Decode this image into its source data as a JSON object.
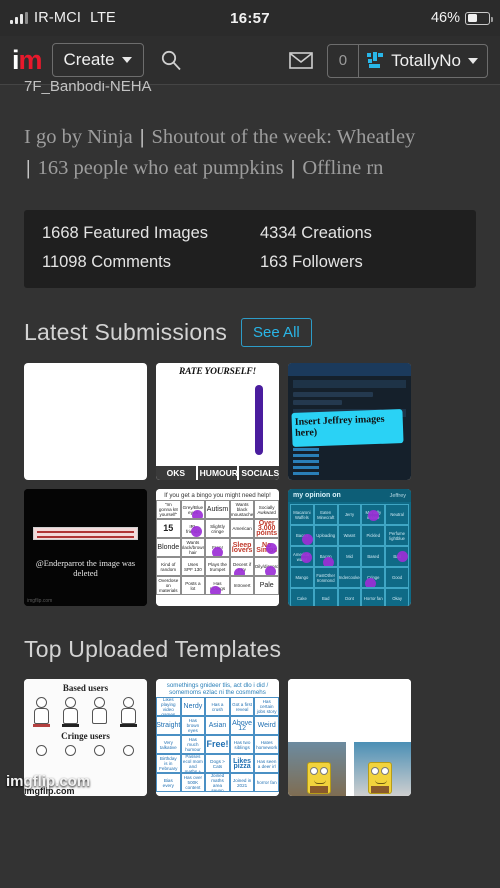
{
  "statusbar": {
    "carrier": "IR-MCI",
    "network": "LTE",
    "time": "16:57",
    "battery": "46%",
    "signal_icon": "signal-bars-icon",
    "battery_icon": "battery-icon"
  },
  "navbar": {
    "logo_i": "i",
    "logo_m": "m",
    "create_label": "Create",
    "search_icon": "search-icon",
    "mail_icon": "mail-icon",
    "notification_count": "0",
    "username": "TotallyNo",
    "avatar_icon": "user-avatar-icon",
    "accent_color": "#29b6e8",
    "brand_red": "#e8192c"
  },
  "profile": {
    "cut_username": "7F_Banbodi-NEHA",
    "bio_parts": [
      "I go by Ninja",
      "Shoutout of the week: Wheatley",
      "163 people who eat pumpkins",
      "Offline rn"
    ],
    "bio_separator": "|",
    "stats": [
      "1668 Featured Images",
      "4334 Creations",
      "11098 Comments",
      "163 Followers"
    ]
  },
  "latest_submissions": {
    "title": "Latest Submissions",
    "see_all_label": "See All",
    "items": [
      {
        "name": "blank-white-meme",
        "kind": "blank"
      },
      {
        "name": "rate-yourself-meme",
        "kind": "rate",
        "title": "RATE YOURSELF!",
        "footer": [
          "OKS",
          "HUMOUR",
          "SOCIALSK"
        ]
      },
      {
        "name": "jeffrey-screenshot-meme",
        "kind": "jeffrey",
        "handwriting": "Insert Jeffrey images here)"
      },
      {
        "name": "deleted-image-meme",
        "kind": "deleted",
        "caption": "@Enderparrot the image was deleted",
        "watermark": "imgflip.com"
      },
      {
        "name": "bingo-card-meme",
        "kind": "bingo",
        "header": "If you get a bingo you might need help!",
        "cells": [
          "\"Im gonna k8 yourself\"",
          "Grey/Blue eyes",
          "Autism",
          "Wants black moustache",
          "Socially Awkward",
          "15",
          "IRL friends",
          "Slightly cringe",
          "American",
          "Over 3,000 points",
          "Blonde",
          "Wants black/brown hair",
          "Fren!",
          "Sleep lovers",
          "No Simps",
          "Kind of random",
          "Uses SPF 130",
          "Plays the trumpet",
          "Decent if I try",
          "Oily/discord",
          "Overdose on materials",
          "Posts a lot",
          "Has siblings",
          "Introvert",
          "Pale"
        ],
        "marked": [
          1,
          6,
          12,
          14,
          18,
          19,
          22
        ]
      },
      {
        "name": "my-opinion-on-grid-meme",
        "kind": "opinion",
        "header": "my opinion on",
        "subheader": "Jeffrey",
        "cells": [
          "Macaroni Waffels",
          "Eaten Minecraft",
          "Jerry",
          "Mentally insane",
          "Neutral",
          "Bacon",
          "Uploading",
          "Wasnt",
          "Pickled",
          "Perfume lightblue",
          "American water",
          "Bacon",
          "Mid",
          "Based",
          "Bad",
          "Mango",
          "FastOther Ironmond",
          "Undercooked",
          "Cringe",
          "Good",
          "Cake",
          "Bad",
          "Dont",
          "Horror fan",
          "Okay"
        ],
        "marked": [
          3,
          5,
          10,
          11,
          14,
          18
        ]
      }
    ]
  },
  "top_templates": {
    "title": "Top Uploaded Templates",
    "items": [
      {
        "name": "based-cringe-users-template",
        "kind": "based",
        "label_top": "Based users",
        "label_bottom": "Cringe users",
        "watermark": "imgflip.com"
      },
      {
        "name": "mirrored-bingo-template",
        "kind": "bingo-blue",
        "header": "somethings gnideer tlis, act dlo i did / somemoms ezlac ni the cosmmehs",
        "cells": [
          "Likes playing video games",
          "Nerdy",
          "Has a crush",
          "Got a first reveal",
          "Has certain jobs story",
          "Straight",
          "Has brown eyes",
          "Asian",
          "Above 12",
          "Weird",
          "Very talkative",
          "Has much humour",
          "Free!",
          "Has two siblings",
          "Hates homework",
          "Birthday is in February",
          "Passes ecol mom and maths +",
          "Dogs > Cats",
          "Likes pizza",
          "Has seen a deer irl",
          "Bias every",
          "Has over 500K content",
          "Joined maths area seven",
          "Joined in 2021",
          "horror fan"
        ],
        "marked": []
      },
      {
        "name": "spongebob-comparison-template",
        "kind": "spongebob"
      }
    ]
  },
  "footer_watermark": "imgflip.com"
}
